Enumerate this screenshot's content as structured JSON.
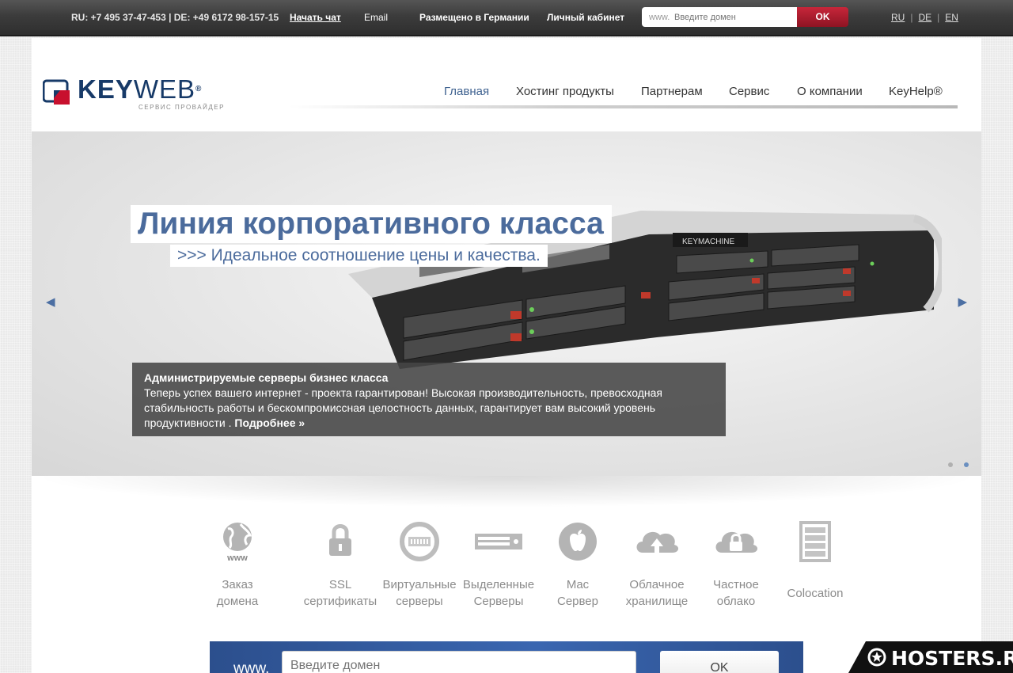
{
  "topbar": {
    "phones": "RU: +7 495 37-47-453 | DE: +49 6172 98-157-15",
    "chat": "Начать чат",
    "email": "Email",
    "germany": "Размещено в Германии",
    "cabinet": "Личный кабинет",
    "search_prefix": "www.",
    "search_placeholder": "Введите домен",
    "ok": "OK",
    "langs": [
      "RU",
      "DE",
      "EN"
    ]
  },
  "logo": {
    "brand_key": "KEY",
    "brand_web": "WEB",
    "registered": "®",
    "subtitle": "СЕРВИС ПРОВАЙДЕР"
  },
  "nav": {
    "items": [
      "Главная",
      "Хостинг продукты",
      "Партнерам",
      "Сервис",
      "О компании",
      "KeyHelp®"
    ],
    "active_index": 0
  },
  "slider": {
    "title": "Линия корпоративного класса",
    "subtitle": ">>> Идеальное соотношение цены и качества.",
    "server_brand": "KEYMACHINE",
    "caption_title": "Администрируемые серверы бизнес класса",
    "caption_text": "Теперь успех вашего интернет - проекта гарантирован! Высокая производительность, превосходная стабильность работы и бескомпромиссная целостность данных, гарантирует вам высокий уровень продуктивности . ",
    "caption_more": "Подробнее »",
    "arrow_left": "◀",
    "arrow_right": "▶",
    "dot_count": 2,
    "active_dot": 1
  },
  "products": [
    {
      "line1": "Заказ",
      "line2": "домена",
      "icon": "globe-www-icon"
    },
    {
      "line1": "SSL",
      "line2": "сертификаты",
      "icon": "padlock-icon"
    },
    {
      "line1": "Виртуальные",
      "line2": "серверы",
      "icon": "virtual-server-icon"
    },
    {
      "line1": "Выделенные",
      "line2": "Серверы",
      "icon": "rack-server-icon"
    },
    {
      "line1": "Mac",
      "line2": "Сервер",
      "icon": "apple-icon"
    },
    {
      "line1": "Облачное",
      "line2": "хранилище",
      "icon": "cloud-upload-icon"
    },
    {
      "line1": "Частное",
      "line2": "облако",
      "icon": "cloud-lock-icon"
    },
    {
      "line1": "Colocation",
      "line2": "",
      "icon": "server-cabinet-icon"
    }
  ],
  "globe_label": "www",
  "domain_search": {
    "prefix": "www.",
    "placeholder": "Введите домен",
    "button": "OK"
  },
  "watermark": "HOSTERS.RU",
  "colors": {
    "accent_blue": "#4b6b9c",
    "ok_red": "#b01c30",
    "domain_bar": "#3a66b0"
  }
}
